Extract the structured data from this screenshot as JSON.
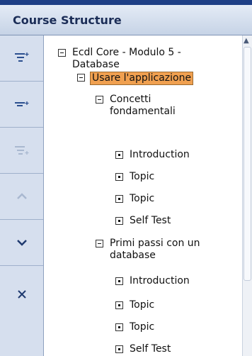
{
  "panel": {
    "title": "Course Structure"
  },
  "toolbar": {
    "buttons": [
      {
        "icon": "add-sibling-icon",
        "enabled": true
      },
      {
        "icon": "add-child-icon",
        "enabled": true
      },
      {
        "icon": "add-disabled-icon",
        "enabled": false
      },
      {
        "icon": "move-up-icon",
        "enabled": false
      },
      {
        "icon": "move-down-icon",
        "enabled": true
      },
      {
        "icon": "delete-icon",
        "enabled": true
      }
    ]
  },
  "tree": {
    "root": {
      "label_line1": "Ecdl Core - Modulo 5 -",
      "label_line2": "Database"
    },
    "module": {
      "label": "Usare l'applicazione",
      "selected": true
    },
    "section1": {
      "label_line1": "Concetti",
      "label_line2": "fondamentali",
      "items": [
        "Introduction",
        "Topic",
        "Topic",
        "Self Test"
      ]
    },
    "section2": {
      "label_line1": "Primi passi con un",
      "label_line2": "database",
      "items": [
        "Introduction",
        "Topic",
        "Topic",
        "Self Test"
      ]
    }
  },
  "colors": {
    "selected_bg": "#f0a050",
    "header_text": "#1b2d57",
    "top_bar": "#1e3f86"
  }
}
